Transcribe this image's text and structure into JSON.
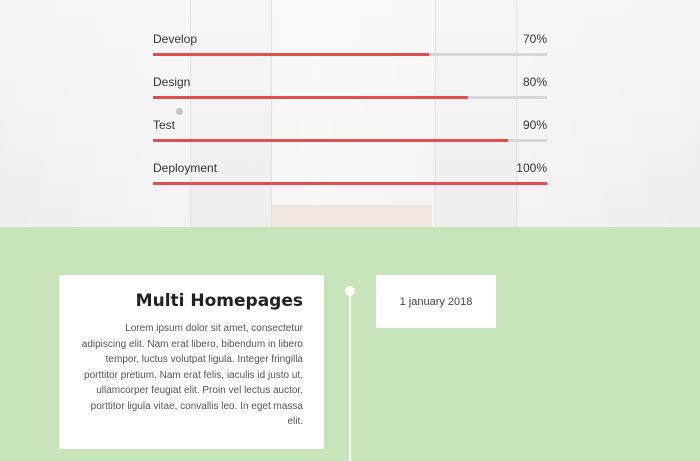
{
  "skills": [
    {
      "label": "Develop",
      "value_text": "70%",
      "level": 0.7
    },
    {
      "label": "Design",
      "value_text": "80%",
      "level": 0.8
    },
    {
      "label": "Test",
      "value_text": "90%",
      "level": 0.9
    },
    {
      "label": "Deployment",
      "value_text": "100%",
      "level": 1.0
    }
  ],
  "timeline": {
    "card_title": "Multi Homepages",
    "card_body": "Lorem ipsum dolor sit amet, consectetur adipiscing elit. Nam erat libero, bibendum in libero tempor, luctus volutpat ligula. Integer fringilla porttitor pretium. Nam erat felis, iaculis id justo ut, ullamcorper feugiat elit. Proin vel lectus auctor, porttitor ligula vitae, convallis leo. In eget massa elit.",
    "date": "1 january 2018"
  },
  "colors": {
    "bar_fill": "#e0504f",
    "bar_track": "#d7d7d7",
    "section_green": "#c8e4bb"
  }
}
